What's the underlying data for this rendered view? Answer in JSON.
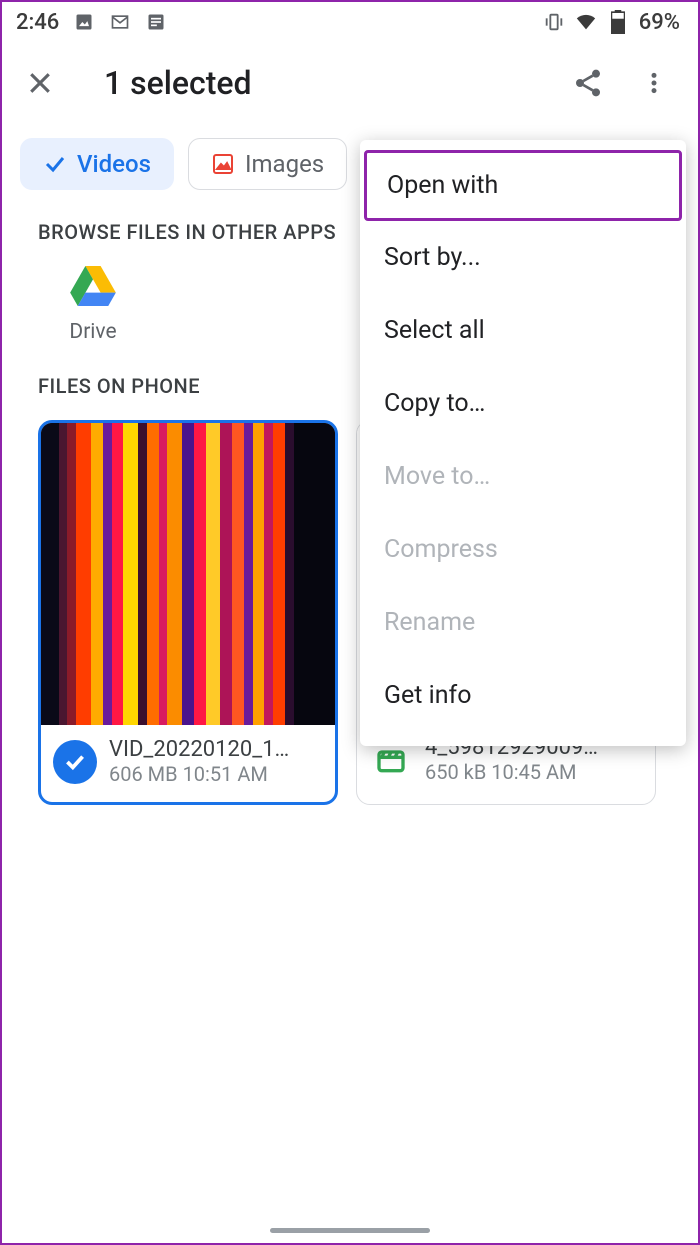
{
  "status": {
    "time": "2:46",
    "battery_percent": "69%",
    "icons": [
      "image-icon",
      "gmail-icon",
      "news-icon",
      "vibrate-icon",
      "wifi-icon",
      "battery-icon"
    ]
  },
  "toolbar": {
    "title": "1 selected"
  },
  "chips": {
    "videos": "Videos",
    "images": "Images"
  },
  "sections": {
    "other_apps": "BROWSE FILES IN OTHER APPS",
    "files_on_phone": "FILES ON PHONE"
  },
  "other_apps": {
    "drive": "Drive"
  },
  "files": [
    {
      "name": "VID_20220120_1…",
      "meta": "606 MB 10:51 AM",
      "selected": true
    },
    {
      "name": "4_59812929009…",
      "meta": "650 kB 10:45 AM",
      "selected": false
    }
  ],
  "menu": {
    "items": [
      {
        "label": "Open with",
        "enabled": true,
        "highlighted": true
      },
      {
        "label": "Sort by...",
        "enabled": true
      },
      {
        "label": "Select all",
        "enabled": true
      },
      {
        "label": "Copy to…",
        "enabled": true
      },
      {
        "label": "Move to…",
        "enabled": false
      },
      {
        "label": "Compress",
        "enabled": false
      },
      {
        "label": "Rename",
        "enabled": false
      },
      {
        "label": "Get info",
        "enabled": true
      }
    ]
  }
}
